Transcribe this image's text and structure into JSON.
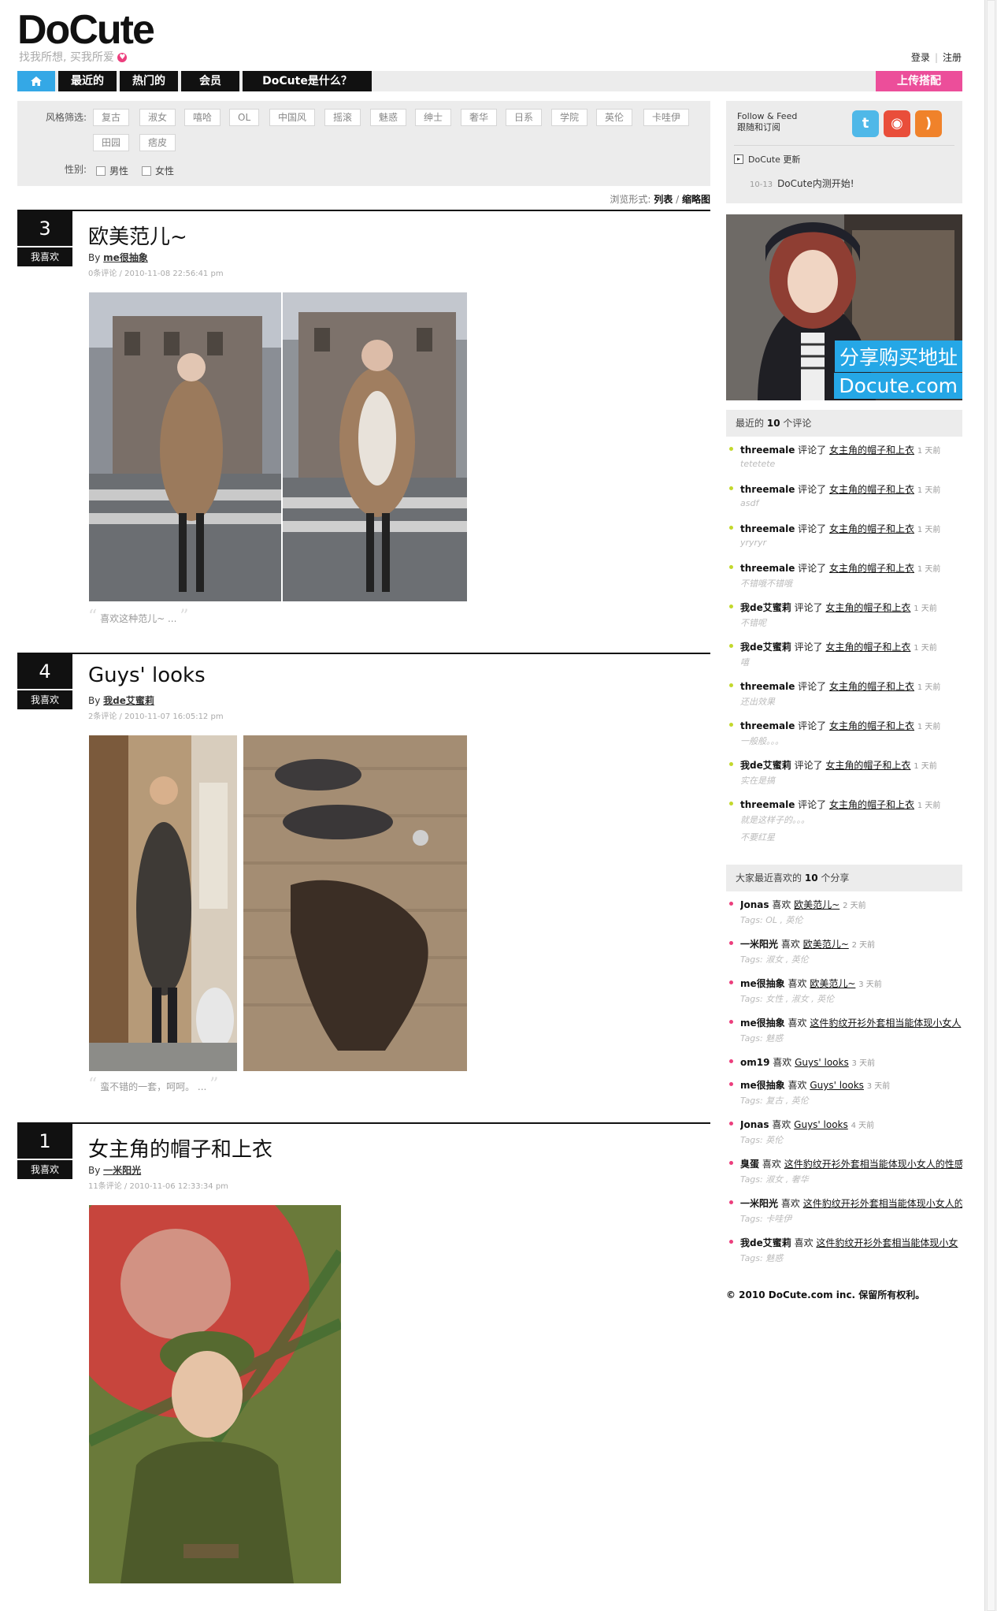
{
  "brand": {
    "logo": "DoCute",
    "tagline": "找我所想, 买我所爱"
  },
  "toplinks": {
    "login": "登录",
    "register": "注册"
  },
  "nav": {
    "items": [
      "最近的",
      "热门的",
      "会员",
      "DoCute是什么？"
    ],
    "upload": "上传搭配"
  },
  "filter": {
    "style_label": "风格筛选:",
    "styles": [
      "复古",
      "淑女",
      "嘻哈",
      "OL",
      "中国风",
      "摇滚",
      "魅惑",
      "绅士",
      "奢华",
      "日系",
      "学院",
      "英伦",
      "卡哇伊",
      "田园",
      "痞皮"
    ],
    "gender_label": "性别:",
    "genders": [
      "男性",
      "女性"
    ]
  },
  "viewmode": {
    "label": "浏览形式:",
    "list": "列表",
    "sep": "/",
    "thumb": "缩略图"
  },
  "posts": [
    {
      "num": "3",
      "like": "我喜欢",
      "title": "欧美范儿~",
      "by": "By",
      "author": "me很抽象",
      "meta": "0条评论 / 2010-11-08 22:56:41 pm",
      "quote": "喜欢这种范儿~ ..."
    },
    {
      "num": "4",
      "like": "我喜欢",
      "title": "Guys' looks",
      "by": "By",
      "author": "我de艾蜜莉",
      "meta": "2条评论 / 2010-11-07 16:05:12 pm",
      "quote": "蛮不错的一套，呵呵。 ..."
    },
    {
      "num": "1",
      "like": "我喜欢",
      "title": "女主角的帽子和上衣",
      "by": "By",
      "author": "一米阳光",
      "meta": "11条评论 / 2010-11-06 12:33:34 pm"
    }
  ],
  "sidebar": {
    "follow": {
      "line1": "Follow & Feed",
      "line2": "跟随和订阅",
      "update_label": "DoCute 更新",
      "news_date": "10-13",
      "news_text": "DoCute内测开始!"
    },
    "ad": {
      "line1": "分享购买地址",
      "line2": "Docute.com"
    },
    "comments_head": {
      "prefix": "最近的",
      "count": "10",
      "suffix": "个评论"
    },
    "comments": [
      {
        "user": "threemale",
        "verb": "评论了",
        "target": "女主角的帽子和上衣",
        "ago": "1 天前",
        "text": "tetetete"
      },
      {
        "user": "threemale",
        "verb": "评论了",
        "target": "女主角的帽子和上衣",
        "ago": "1 天前",
        "text": "asdf"
      },
      {
        "user": "threemale",
        "verb": "评论了",
        "target": "女主角的帽子和上衣",
        "ago": "1 天前",
        "text": "yryryr"
      },
      {
        "user": "threemale",
        "verb": "评论了",
        "target": "女主角的帽子和上衣",
        "ago": "1 天前",
        "text": "不错哦不错哦"
      },
      {
        "user": "我de艾蜜莉",
        "verb": "评论了",
        "target": "女主角的帽子和上衣",
        "ago": "1 天前",
        "text": "不错呢"
      },
      {
        "user": "我de艾蜜莉",
        "verb": "评论了",
        "target": "女主角的帽子和上衣",
        "ago": "1 天前",
        "text": "嘻"
      },
      {
        "user": "threemale",
        "verb": "评论了",
        "target": "女主角的帽子和上衣",
        "ago": "1 天前",
        "text": "还出效果"
      },
      {
        "user": "threemale",
        "verb": "评论了",
        "target": "女主角的帽子和上衣",
        "ago": "1 天前",
        "text": "一般般。。。"
      },
      {
        "user": "我de艾蜜莉",
        "verb": "评论了",
        "target": "女主角的帽子和上衣",
        "ago": "1 天前",
        "text": "实在是搞"
      },
      {
        "user": "threemale",
        "verb": "评论了",
        "target": "女主角的帽子和上衣",
        "ago": "1 天前",
        "text": "就是这样子的。。。",
        "text2": "不要红星"
      }
    ],
    "likes_head": {
      "prefix": "大家最近喜欢的",
      "count": "10",
      "suffix": "个分享"
    },
    "likes": [
      {
        "user": "Jonas",
        "verb": "喜欢",
        "target": "欧美范儿~",
        "ago": "2 天前",
        "tags": "Tags: OL , 英伦"
      },
      {
        "user": "一米阳光",
        "verb": "喜欢",
        "target": "欧美范儿~",
        "ago": "2 天前",
        "tags": "Tags: 淑女 , 英伦"
      },
      {
        "user": "me很抽象",
        "verb": "喜欢",
        "target": "欧美范儿~",
        "ago": "3 天前",
        "tags": "Tags: 女性 , 淑女 , 英伦"
      },
      {
        "user": "me很抽象",
        "verb": "喜欢",
        "target": "这件豹纹开衫外套相当能体现小女人",
        "ago": "",
        "tags": "Tags: 魅惑"
      },
      {
        "user": "om19",
        "verb": "喜欢",
        "target": "Guys' looks",
        "ago": "3 天前",
        "tags": ""
      },
      {
        "user": "me很抽象",
        "verb": "喜欢",
        "target": "Guys' looks",
        "ago": "3 天前",
        "tags": "Tags: 复古 , 英伦"
      },
      {
        "user": "Jonas",
        "verb": "喜欢",
        "target": "Guys' looks",
        "ago": "4 天前",
        "tags": "Tags: 英伦"
      },
      {
        "user": "臭蛋",
        "verb": "喜欢",
        "target": "这件豹纹开衫外套相当能体现小女人的性感",
        "ago": "",
        "tags": "Tags: 淑女 , 奢华"
      },
      {
        "user": "一米阳光",
        "verb": "喜欢",
        "target": "这件豹纹开衫外套相当能体现小女人的",
        "ago": "",
        "tags": "Tags: 卡哇伊"
      },
      {
        "user": "我de艾蜜莉",
        "verb": "喜欢",
        "target": "这件豹纹开衫外套相当能体现小女",
        "ago": "",
        "tags": "Tags: 魅惑"
      }
    ]
  },
  "footer": {
    "copyright": "© 2010 DoCute.com inc. 保留所有权利。"
  },
  "colors": {
    "accent_blue": "#34a8e6",
    "accent_pink": "#ec4e9a",
    "comment_dot": "#c3d82c",
    "like_dot": "#ec3e7d"
  }
}
